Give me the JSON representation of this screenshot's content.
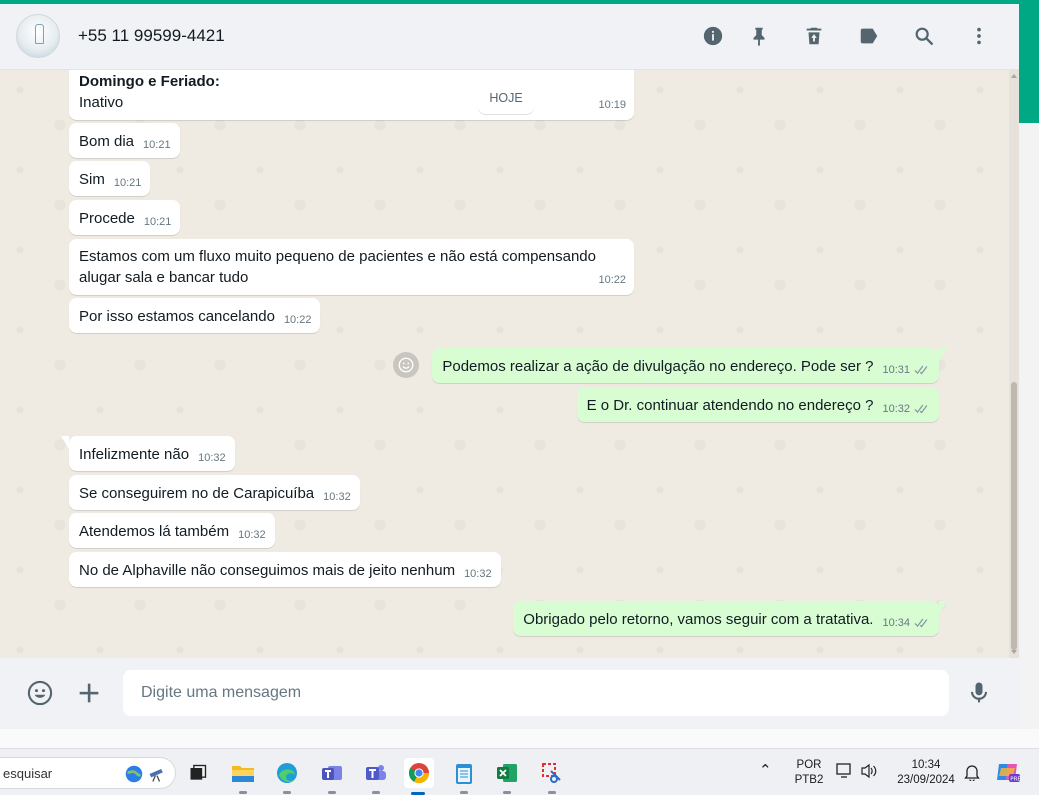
{
  "header": {
    "contact": "+55 11 99599-4421",
    "icons": [
      "info-icon",
      "pin-icon",
      "delete-icon",
      "label-icon",
      "search-icon",
      "menu-icon"
    ]
  },
  "chat": {
    "date_divider": "HOJE",
    "first_message": {
      "title": "Domingo e Feriado:",
      "text": "Inativo",
      "time": "10:19"
    },
    "messages": [
      {
        "dir": "in",
        "text": "Bom dia",
        "time": "10:21"
      },
      {
        "dir": "in",
        "text": "Sim",
        "time": "10:21"
      },
      {
        "dir": "in",
        "text": "Procede",
        "time": "10:21"
      },
      {
        "dir": "in",
        "text": "Estamos com um fluxo muito pequeno de pacientes e não está compensando alugar sala e bancar tudo",
        "time": "10:22"
      },
      {
        "dir": "in",
        "text": "Por isso estamos cancelando",
        "time": "10:22"
      },
      {
        "dir": "out",
        "text": "Podemos realizar a ação de divulgação no endereço. Pode ser ?",
        "time": "10:31"
      },
      {
        "dir": "out",
        "text": "E o Dr. continuar atendendo no endereço ?",
        "time": "10:32"
      },
      {
        "dir": "in",
        "text": "Infelizmente não",
        "time": "10:32"
      },
      {
        "dir": "in",
        "text": "Se conseguirem no de Carapicuíba",
        "time": "10:32"
      },
      {
        "dir": "in",
        "text": "Atendemos lá também",
        "time": "10:32"
      },
      {
        "dir": "in",
        "text": "No de Alphaville não conseguimos mais de jeito nenhum",
        "time": "10:32"
      },
      {
        "dir": "out",
        "text": "Obrigado pelo retorno, vamos seguir com a tratativa.",
        "time": "10:34"
      }
    ]
  },
  "composer": {
    "placeholder": "Digite uma mensagem"
  },
  "taskbar": {
    "search_label": "esquisar",
    "apps": [
      "file-explorer",
      "edge",
      "teams-classic",
      "teams",
      "chrome",
      "notepad",
      "excel",
      "snipping-tool"
    ],
    "active_app": "chrome",
    "lang_line1": "POR",
    "lang_line2": "PTB2",
    "time": "10:34",
    "date": "23/09/2024"
  },
  "colors": {
    "accent": "#00a884",
    "incoming_bubble": "#ffffff",
    "outgoing_bubble": "#d9fdd3",
    "chat_bg": "#efeae2",
    "read_ticks": "#8696a0"
  }
}
